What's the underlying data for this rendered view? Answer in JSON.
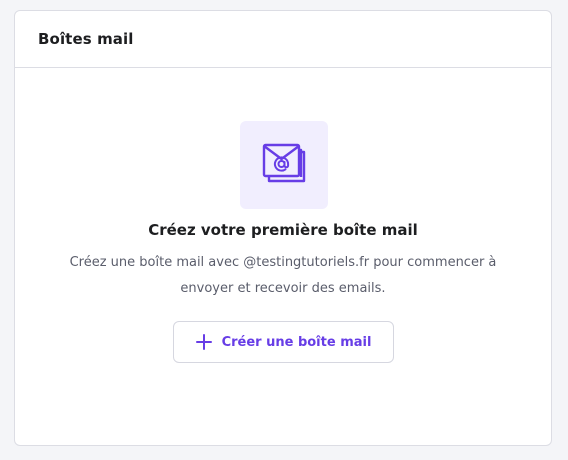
{
  "card": {
    "title": "Boîtes mail"
  },
  "empty_state": {
    "icon": "mail-at-icon",
    "title": "Créez votre première boîte mail",
    "description": "Créez une boîte mail avec @testingtutoriels.fr pour commencer à envoyer et recevoir des emails.",
    "button_label": "Créer une boîte mail",
    "button_icon": "plus-icon"
  },
  "colors": {
    "accent": "#673de6",
    "icon_tile_bg": "#f1eefe",
    "text_primary": "#1d1e20",
    "text_secondary": "#5a5d6b",
    "border": "#dcdde4"
  }
}
